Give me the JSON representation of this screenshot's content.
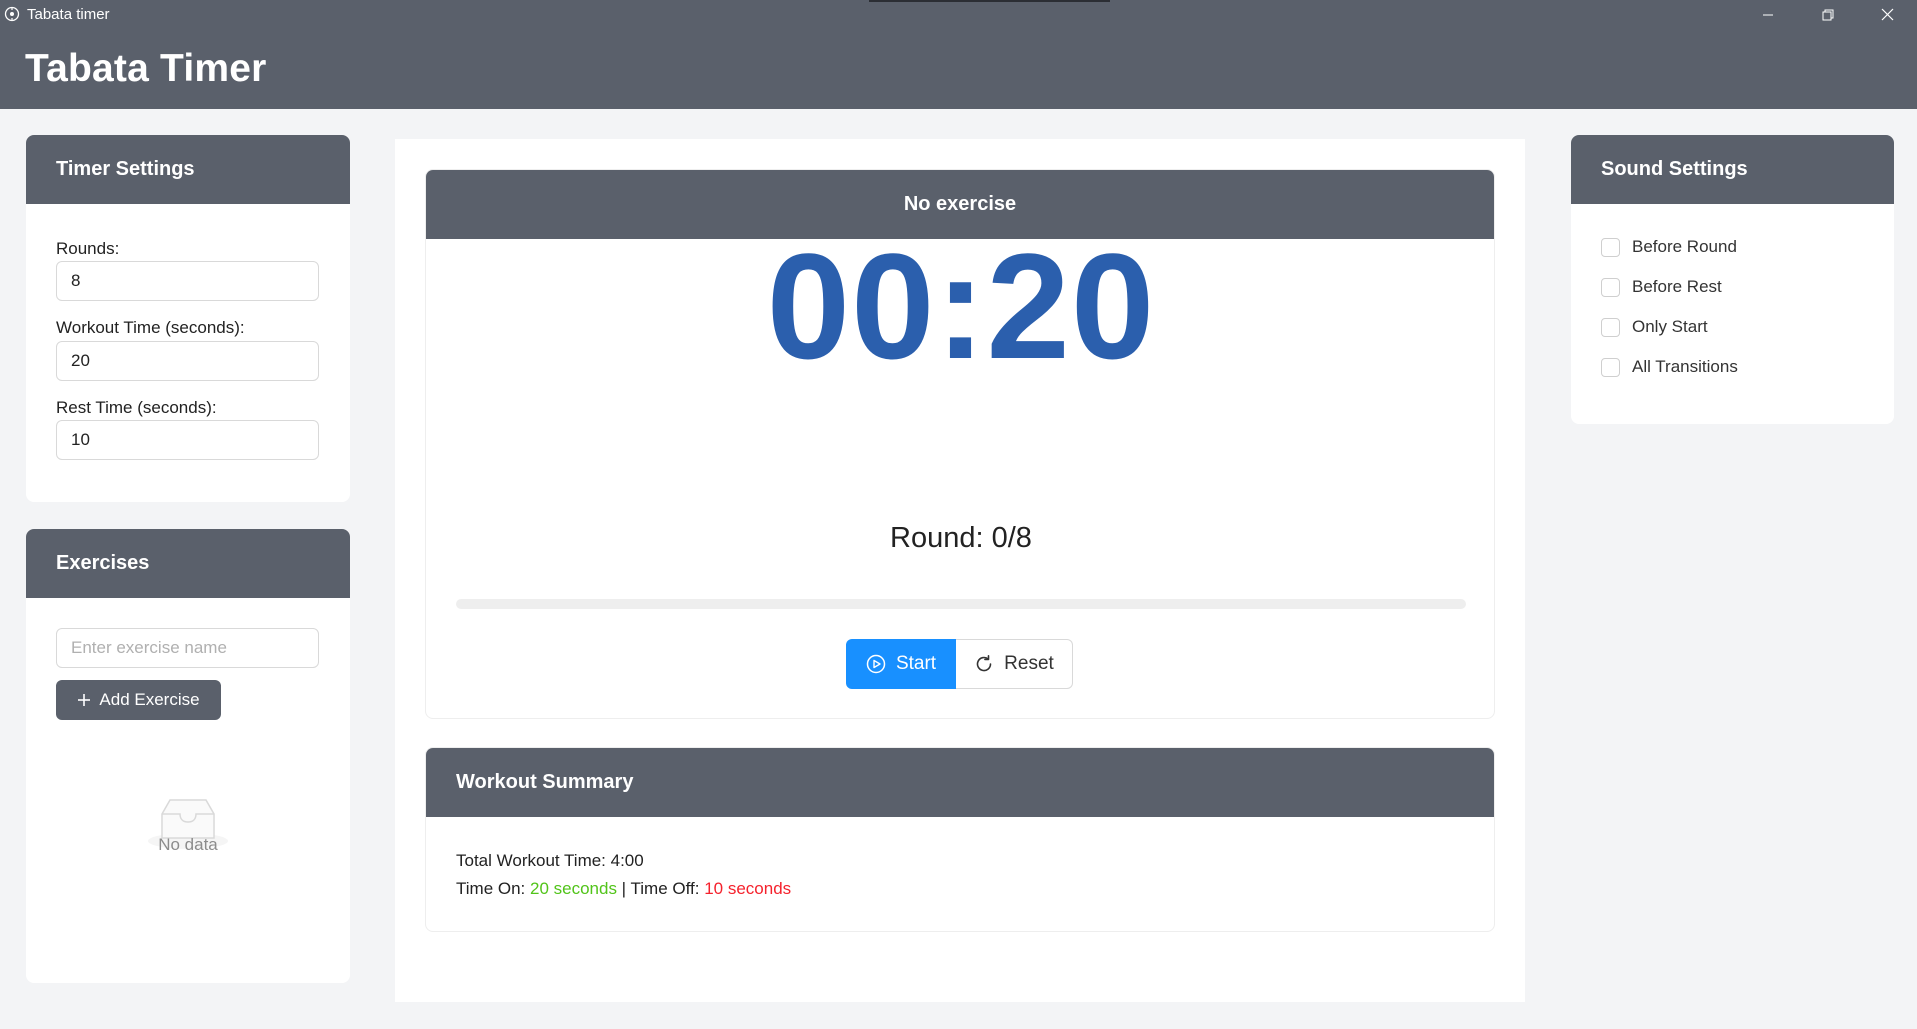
{
  "window": {
    "title": "Tabata timer",
    "minimize_icon": "minimize-icon",
    "restore_icon": "restore-icon",
    "close_icon": "close-icon"
  },
  "header": {
    "title": "Tabata Timer"
  },
  "timer_settings": {
    "title": "Timer Settings",
    "rounds_label": "Rounds:",
    "rounds_value": "8",
    "workout_label": "Workout Time (seconds):",
    "workout_value": "20",
    "rest_label": "Rest Time (seconds):",
    "rest_value": "10"
  },
  "exercises": {
    "title": "Exercises",
    "input_placeholder": "Enter exercise name",
    "add_button_label": "Add Exercise",
    "empty_text": "No data"
  },
  "timer": {
    "exercise_name": "No exercise",
    "time_display": "00:20",
    "round_text": "Round: 0/8",
    "progress_fraction": 0,
    "start_label": "Start",
    "reset_label": "Reset"
  },
  "summary": {
    "title": "Workout Summary",
    "total_label": "Total Workout Time: 4:00",
    "time_on_label": "Time On: ",
    "time_on_value": "20 seconds",
    "separator": " | ",
    "time_off_label": "Time Off: ",
    "time_off_value": "10 seconds"
  },
  "sound_settings": {
    "title": "Sound Settings",
    "options": [
      {
        "label": "Before Round",
        "checked": false
      },
      {
        "label": "Before Rest",
        "checked": false
      },
      {
        "label": "Only Start",
        "checked": false
      },
      {
        "label": "All Transitions",
        "checked": false
      }
    ]
  },
  "colors": {
    "header_bg": "#5a606b",
    "timer_digits": "#2b5fad",
    "primary": "#1890ff",
    "time_on": "#52c41a",
    "time_off": "#f5222d"
  }
}
